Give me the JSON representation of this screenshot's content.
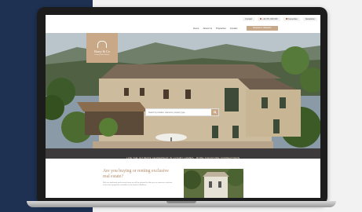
{
  "utility_bar": {
    "links": [
      "Contact",
      "+34 971 000 000",
      "Favourites",
      "Newsletter"
    ]
  },
  "nav": {
    "items": [
      "Home",
      "About Us",
      "Properties",
      "Contact"
    ],
    "cta_label": "Request a Valuation"
  },
  "logo": {
    "name": "Barry & Co",
    "subtitle": "Luxury Real Estate"
  },
  "search": {
    "placeholder": "Search by location, reference, property type..."
  },
  "tagline": "LIVE THE ULTIMATE LEADERSHIP IN LUXURY HOMES · MORE SIGNATURE CONNECTIONS",
  "intro": {
    "heading": "Are you buying or renting exclusive real estate?",
    "body": "With our dedicated professional team we will be pleased to offer you an extensive selection of the finest properties available on the island of Mallorca."
  },
  "colors": {
    "brand_tan": "#c8a887",
    "navy": "#1e3152",
    "dark_strip": "#3c3a3a"
  }
}
